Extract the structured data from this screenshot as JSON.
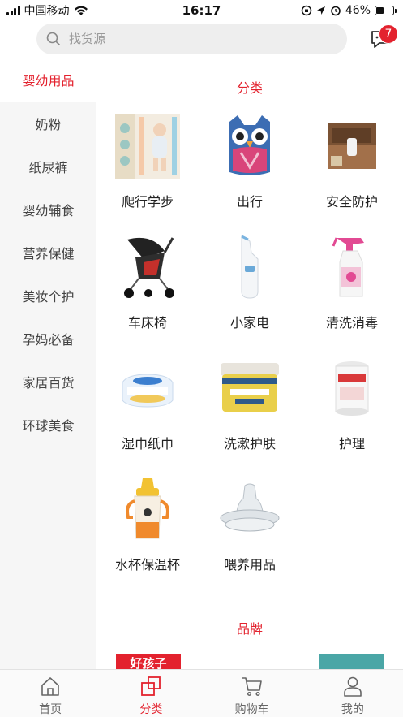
{
  "status_bar": {
    "carrier": "中国移动",
    "time": "16:17",
    "battery": "46%",
    "battery_level": 0.46
  },
  "search": {
    "placeholder": "找货源"
  },
  "messages": {
    "badge": "7"
  },
  "sidebar": {
    "items": [
      {
        "label": "婴幼用品",
        "active": true
      },
      {
        "label": "奶粉"
      },
      {
        "label": "纸尿裤"
      },
      {
        "label": "婴幼辅食"
      },
      {
        "label": "营养保健"
      },
      {
        "label": "美妆个护"
      },
      {
        "label": "孕妈必备"
      },
      {
        "label": "家居百货"
      },
      {
        "label": "环球美食"
      }
    ]
  },
  "main": {
    "category_title": "分类",
    "brand_title": "品牌",
    "categories": [
      {
        "label": "爬行学步",
        "icon": "play-mat-icon"
      },
      {
        "label": "出行",
        "icon": "owl-backpack-icon"
      },
      {
        "label": "安全防护",
        "icon": "drawer-lock-icon"
      },
      {
        "label": "车床椅",
        "icon": "stroller-icon"
      },
      {
        "label": "小家电",
        "icon": "ear-thermometer-icon"
      },
      {
        "label": "清洗消毒",
        "icon": "spray-bottle-icon"
      },
      {
        "label": "湿巾纸巾",
        "icon": "wet-wipes-icon"
      },
      {
        "label": "洗漱护肤",
        "icon": "cream-jar-icon"
      },
      {
        "label": "护理",
        "icon": "cotton-swab-box-icon"
      },
      {
        "label": "水杯保温杯",
        "icon": "sippy-cup-icon"
      },
      {
        "label": "喂养用品",
        "icon": "nipple-icon"
      }
    ],
    "brand_banner_text": "好孩子"
  },
  "tabbar": {
    "items": [
      {
        "label": "首页",
        "icon": "home-icon"
      },
      {
        "label": "分类",
        "icon": "category-icon",
        "active": true
      },
      {
        "label": "购物车",
        "icon": "cart-icon"
      },
      {
        "label": "我的",
        "icon": "profile-icon"
      }
    ]
  },
  "colors": {
    "accent": "#e3222e",
    "sidebar_bg": "#f6f6f6"
  }
}
